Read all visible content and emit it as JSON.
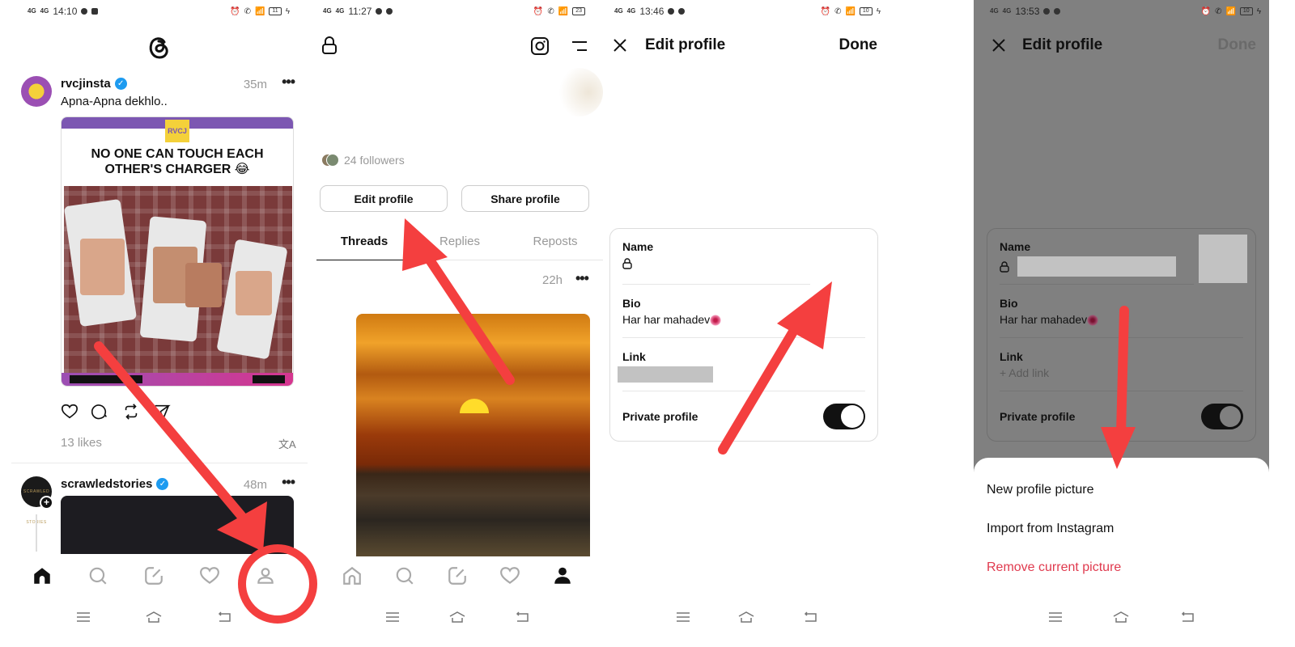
{
  "colors": {
    "annotation_red": "#f43f3f",
    "verified_blue": "#1d9bf0",
    "danger_red": "#e03a4e",
    "overlay_gray": "#808080"
  },
  "panels": [
    {
      "status_bar": {
        "time": "14:10",
        "signal": [
          "4G",
          "4G"
        ],
        "battery": "11"
      },
      "app_logo": "threads-logo",
      "posts": [
        {
          "username": "rvcjinsta",
          "verified": true,
          "time": "35m",
          "caption": "Apna-Apna dekhlo..",
          "media": {
            "logo_text": "RVCJ",
            "title_line1": "NO ONE CAN TOUCH EACH",
            "title_line2": "OTHER'S CHARGER 😂"
          },
          "likes": "13 likes",
          "actions": [
            "like-icon",
            "comment-icon",
            "repost-icon",
            "share-icon"
          ]
        },
        {
          "username": "scrawledstories",
          "avatar_text": "SCRAWLED STORIES",
          "verified": true,
          "time": "48m"
        }
      ],
      "bottom_nav": [
        "home",
        "search",
        "compose",
        "activity",
        "profile"
      ],
      "bottom_nav_active": "home",
      "annotation": "arrow-to-profile-tab"
    },
    {
      "status_bar": {
        "time": "11:27",
        "signal": [
          "4G",
          "4G"
        ],
        "battery": "23"
      },
      "followers": "24 followers",
      "buttons": {
        "edit_profile": "Edit profile",
        "share_profile": "Share profile"
      },
      "tabs": [
        "Threads",
        "Replies",
        "Reposts"
      ],
      "active_tab": "Threads",
      "post": {
        "time": "22h"
      },
      "bottom_nav": [
        "home",
        "search",
        "compose",
        "activity",
        "profile"
      ],
      "bottom_nav_active": "profile",
      "annotation": "arrow-to-edit-profile"
    },
    {
      "status_bar": {
        "time": "13:46",
        "signal": [
          "4G",
          "4G"
        ],
        "battery": "10"
      },
      "header": {
        "title": "Edit profile",
        "done": "Done"
      },
      "fields": {
        "name_label": "Name",
        "bio_label": "Bio",
        "bio_value": "Har har mahadev",
        "link_label": "Link",
        "private_label": "Private profile",
        "private_enabled": true
      },
      "annotation": "arrow-to-profile-picture"
    },
    {
      "status_bar": {
        "time": "13:53",
        "signal": [
          "4G",
          "4G"
        ],
        "battery": "10"
      },
      "header": {
        "title": "Edit profile",
        "done": "Done"
      },
      "fields": {
        "name_label": "Name",
        "bio_label": "Bio",
        "bio_value": "Har har mahadev",
        "link_label": "Link",
        "link_placeholder": "+ Add link",
        "private_label": "Private profile",
        "private_enabled": true
      },
      "sheet": {
        "items": [
          "New profile picture",
          "Import from Instagram",
          "Remove current picture"
        ]
      },
      "annotation": "arrow-to-sheet"
    }
  ]
}
